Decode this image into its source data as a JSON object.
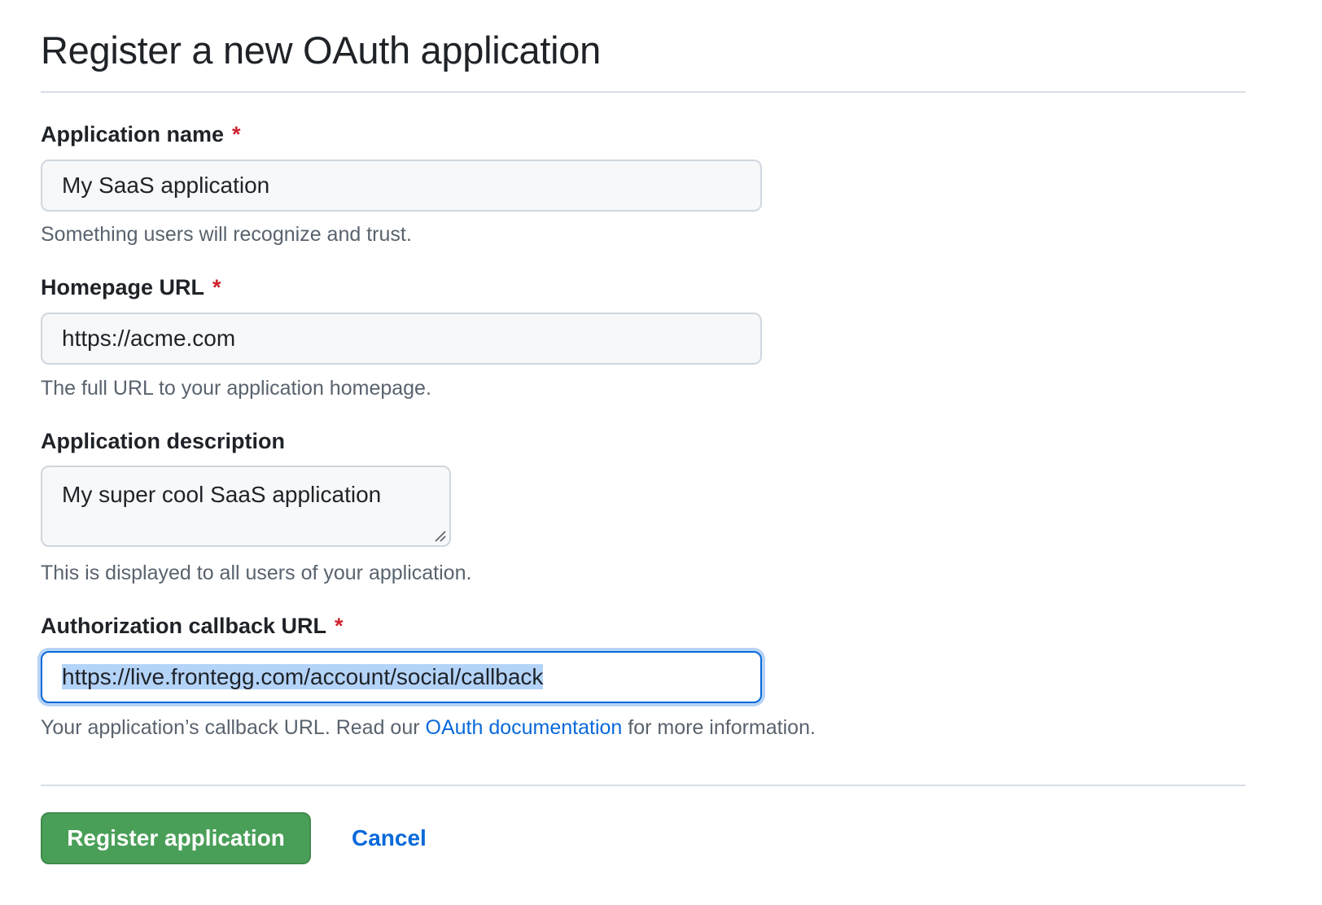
{
  "page": {
    "title": "Register a new OAuth application"
  },
  "fields": {
    "app_name": {
      "label": "Application name",
      "required_mark": "*",
      "value": "My SaaS application",
      "note": "Something users will recognize and trust."
    },
    "homepage_url": {
      "label": "Homepage URL",
      "required_mark": "*",
      "value": "https://acme.com",
      "note": "The full URL to your application homepage."
    },
    "description": {
      "label": "Application description",
      "value": "My super cool SaaS application",
      "note": "This is displayed to all users of your application."
    },
    "callback_url": {
      "label": "Authorization callback URL",
      "required_mark": "*",
      "value": "https://live.frontegg.com/account/social/callback",
      "note_before": "Your application’s callback URL. Read our ",
      "note_link": "OAuth documentation",
      "note_after": " for more information."
    }
  },
  "actions": {
    "register_label": "Register application",
    "cancel_label": "Cancel"
  },
  "colors": {
    "primary_button": "#4a9f58",
    "link": "#0969da",
    "required": "#cf222e",
    "focus_ring": "#b6d3f5"
  }
}
